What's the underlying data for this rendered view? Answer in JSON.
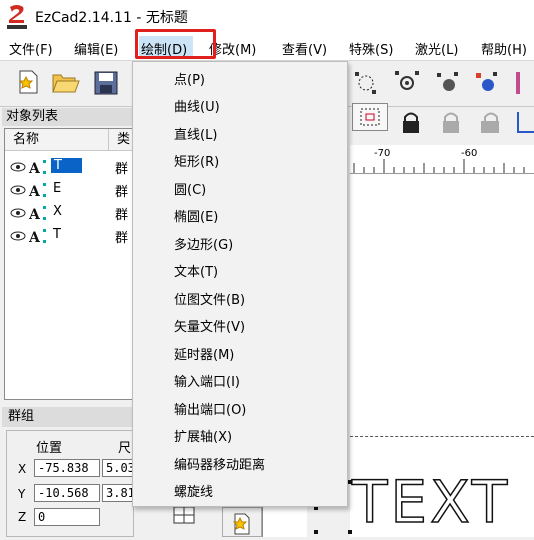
{
  "window": {
    "title": "EzCad2.14.11 - 无标题",
    "logo_text": "EZCAD"
  },
  "menu": [
    {
      "label": "文件(F)"
    },
    {
      "label": "编辑(E)"
    },
    {
      "label": "绘制(D)"
    },
    {
      "label": "修改(M)"
    },
    {
      "label": "查看(V)"
    },
    {
      "label": "特殊(S)"
    },
    {
      "label": "激光(L)"
    },
    {
      "label": "帮助(H)"
    }
  ],
  "draw_menu": [
    {
      "label": "点(P)"
    },
    {
      "label": "曲线(U)"
    },
    {
      "label": "直线(L)"
    },
    {
      "label": "矩形(R)"
    },
    {
      "label": "圆(C)"
    },
    {
      "label": "椭圆(E)"
    },
    {
      "label": "多边形(G)"
    },
    {
      "label": "文本(T)"
    },
    {
      "label": "位图文件(B)"
    },
    {
      "label": "矢量文件(V)"
    },
    {
      "label": "延时器(M)"
    },
    {
      "label": "输入端口(I)"
    },
    {
      "label": "输出端口(O)"
    },
    {
      "label": "扩展轴(X)"
    },
    {
      "label": "编码器移动距离"
    },
    {
      "label": "螺旋线"
    }
  ],
  "object_list": {
    "title": "对象列表",
    "col_name": "名称",
    "col_type": "类",
    "rows": [
      {
        "name": "T",
        "type": "群",
        "selected": true
      },
      {
        "name": "E",
        "type": "群",
        "selected": false
      },
      {
        "name": "X",
        "type": "群",
        "selected": false
      },
      {
        "name": "T",
        "type": "群",
        "selected": false
      }
    ]
  },
  "group_panel": {
    "title": "群组",
    "pos_label": "位置",
    "size_label": "尺",
    "x_label": "X",
    "y_label": "Y",
    "z_label": "Z",
    "x_value": "-75.838",
    "y_value": "-10.568",
    "z_value": "0",
    "x_size": "5.03",
    "y_size": "3.81"
  },
  "ruler": {
    "labels": [
      "-70",
      "-60"
    ]
  },
  "canvas_text": "TEXT",
  "colors": {
    "highlight_box": "#e0201c",
    "selection": "#0a64c8",
    "menu_hover": "#cce4f7"
  }
}
